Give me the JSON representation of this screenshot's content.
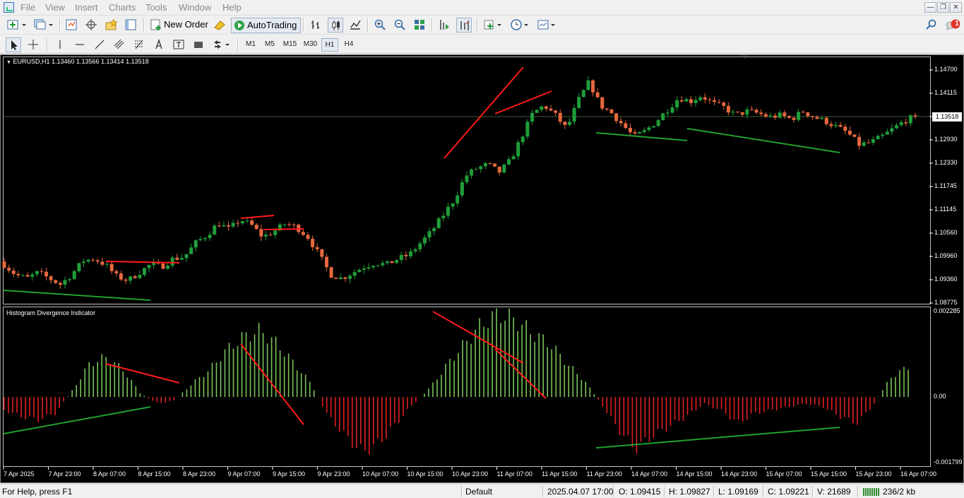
{
  "menu": [
    "File",
    "View",
    "Insert",
    "Charts",
    "Tools",
    "Window",
    "Help"
  ],
  "window_controls": [
    "minimize",
    "restore",
    "close"
  ],
  "toolbar": {
    "new_order": "New Order",
    "autotrading": "AutoTrading",
    "notification_count": "1"
  },
  "timeframes": [
    "M1",
    "M5",
    "M15",
    "M30",
    "H1",
    "H4"
  ],
  "active_timeframe": "H1",
  "price_chart": {
    "header": "EURUSD,H1  1.13460 1.13566 1.13414 1.13518",
    "current_price": "1.13518",
    "y_labels": [
      "1.14700",
      "1.14115",
      "1.13518",
      "1.12930",
      "1.12330",
      "1.11745",
      "1.11145",
      "1.10560",
      "1.09960",
      "1.09360",
      "1.08775"
    ]
  },
  "indicator": {
    "title": "Histogram Divergence Indicator",
    "y_labels": [
      "0.002285",
      "0.00",
      "-0.001799"
    ]
  },
  "x_labels": [
    "7 Apr 2025",
    "7 Apr 23:00",
    "8 Apr 07:00",
    "8 Apr 15:00",
    "8 Apr 23:00",
    "9 Apr 07:00",
    "9 Apr 15:00",
    "9 Apr 23:00",
    "10 Apr 07:00",
    "10 Apr 15:00",
    "10 Apr 23:00",
    "11 Apr 07:00",
    "11 Apr 15:00",
    "11 Apr 23:00",
    "14 Apr 07:00",
    "14 Apr 15:00",
    "14 Apr 23:00",
    "15 Apr 07:00",
    "15 Apr 15:00",
    "15 Apr 23:00",
    "16 Apr 07:00"
  ],
  "status": {
    "help": "For Help, press F1",
    "profile": "Default",
    "datetime": "2025.04.07 17:00",
    "open": "O: 1.09415",
    "high": "H: 1.09827",
    "low": "L: 1.09169",
    "close": "C: 1.09221",
    "volume": "V: 21689",
    "traffic": "236/2 kb"
  },
  "colors": {
    "background": "#000000",
    "bull": "#1f9e3a",
    "bear": "#e8683e",
    "histogram_positive": "#78c45a",
    "histogram_negative": "#e02020",
    "divergence_bear": "#ff1a1a",
    "divergence_bull": "#22a030"
  },
  "chart_data": [
    {
      "type": "candlestick",
      "symbol": "EURUSD",
      "timeframe": "H1",
      "last_bar": {
        "open": 1.1346,
        "high": 1.13566,
        "low": 1.13414,
        "close": 1.13518
      },
      "ylim": [
        1.08775,
        1.149
      ],
      "path_closes": [
        1.0975,
        1.095,
        1.094,
        1.0955,
        1.094,
        1.0925,
        1.095,
        1.0985,
        1.099,
        1.0975,
        1.0945,
        1.0935,
        1.0955,
        1.0975,
        1.097,
        1.099,
        1.0995,
        1.103,
        1.105,
        1.108,
        1.1065,
        1.109,
        1.1075,
        1.1045,
        1.106,
        1.108,
        1.107,
        1.1045,
        1.1,
        1.095,
        1.094,
        1.0955,
        1.097,
        1.098,
        1.0975,
        1.099,
        1.1,
        1.103,
        1.106,
        1.11,
        1.114,
        1.12,
        1.122,
        1.123,
        1.121,
        1.124,
        1.13,
        1.136,
        1.138,
        1.1355,
        1.132,
        1.139,
        1.144,
        1.138,
        1.136,
        1.133,
        1.13,
        1.1315,
        1.134,
        1.137,
        1.14,
        1.139,
        1.1405,
        1.1385,
        1.1375,
        1.1355,
        1.1365,
        1.136,
        1.135,
        1.1355,
        1.1345,
        1.1365,
        1.135,
        1.134,
        1.1325,
        1.131,
        1.128,
        1.1285,
        1.13,
        1.132,
        1.134,
        1.1352
      ]
    },
    {
      "type": "histogram",
      "name": "Histogram Divergence Indicator",
      "ylim": [
        -0.001799,
        0.002285
      ],
      "path_values": [
        -0.0004,
        -0.0006,
        -0.0007,
        -0.0005,
        0.0002,
        0.001,
        0.0012,
        0.0008,
        0.0001,
        -0.0002,
        -0.0001,
        0.0004,
        0.0008,
        0.0014,
        0.0018,
        0.002,
        0.0016,
        0.001,
        0.0004,
        -0.0006,
        -0.0012,
        -0.0017,
        -0.0014,
        -0.0008,
        -0.0002,
        0.0003,
        0.001,
        0.0016,
        0.0022,
        0.0025,
        0.0023,
        0.0019,
        0.0016,
        0.001,
        0.0005,
        -0.0002,
        -0.001,
        -0.0016,
        -0.0012,
        -0.0009,
        -0.0006,
        -0.0002,
        -0.0004,
        -0.0008,
        -0.0005,
        -0.0004,
        -0.0003,
        -0.0002,
        -0.0003,
        -0.0006,
        -0.0008,
        -0.0002,
        0.0006,
        0.0009
      ]
    }
  ]
}
